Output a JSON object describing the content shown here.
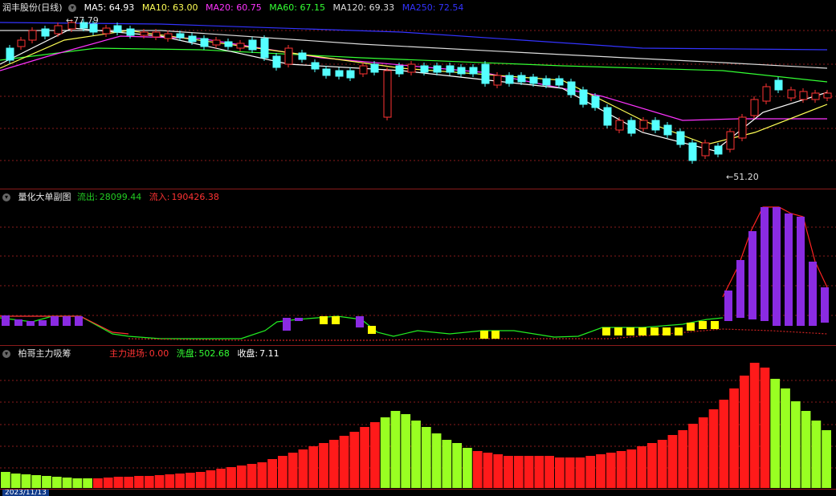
{
  "main": {
    "stock_name": "润丰股份(日线)",
    "ma": [
      {
        "label": "MA5: 64.93",
        "color": "#ffffff"
      },
      {
        "label": "MA10: 63.00",
        "color": "#ffff55"
      },
      {
        "label": "MA20: 60.75",
        "color": "#ff33ff"
      },
      {
        "label": "MA60: 67.15",
        "color": "#33ff33"
      },
      {
        "label": "MA120: 69.33",
        "color": "#dddddd"
      },
      {
        "label": "MA250: 72.54",
        "color": "#3333ff"
      }
    ],
    "high_label": "77.79",
    "low_label": "51.20"
  },
  "sub1": {
    "title": "量化大单副图",
    "outflow_label": "流出:",
    "outflow_value": "28099.44",
    "inflow_label": "流入:",
    "inflow_value": "190426.38",
    "outflow_color": "#22cc22",
    "inflow_color": "#ff3333"
  },
  "sub2": {
    "title": "柏哥主力吸筹",
    "main_label": "主力进场:",
    "main_value": "0.00",
    "wash_label": "洗盘:",
    "wash_value": "502.68",
    "close_label": "收盘:",
    "close_value": "7.11"
  },
  "axis": {
    "date_label": "2023/11/13"
  },
  "colors": {
    "up": "#ff3333",
    "down": "#55ffff",
    "grid": "#8a1b1b",
    "bar_red": "#ff1a1a",
    "bar_green": "#99ff22",
    "purple": "#8a2be2",
    "yellow": "#ffff00"
  }
}
